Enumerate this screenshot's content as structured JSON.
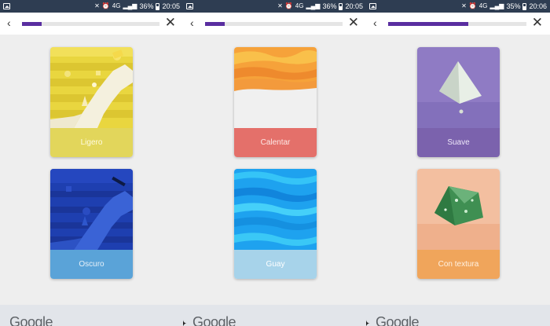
{
  "screens": [
    {
      "status": {
        "signal": "4G",
        "battery": "36%",
        "time": "20:05"
      },
      "progress": 0.14,
      "cards": [
        {
          "label": "Ligero",
          "art": "yellow-stairs-scene",
          "label_bg": "#e2d65b",
          "label_color": "#fffbe0"
        },
        {
          "label": "Oscuro",
          "art": "blue-stairs-scene",
          "label_bg": "#5aa3d8",
          "label_color": "#e6f0f8"
        }
      ],
      "footer": {
        "brand": "Google"
      }
    },
    {
      "status": {
        "signal": "4G",
        "battery": "36%",
        "time": "20:05"
      },
      "progress": 0.14,
      "cards": [
        {
          "label": "Calentar",
          "art": "orange-waves",
          "label_bg": "#e4706a",
          "label_color": "#fde8e6"
        },
        {
          "label": "Guay",
          "art": "cyan-waves",
          "label_bg": "#a7d3ea",
          "label_color": "#ffffff"
        }
      ],
      "footer": {
        "brand": "Google"
      }
    },
    {
      "status": {
        "signal": "4G",
        "battery": "35%",
        "time": "20:06"
      },
      "progress": 0.58,
      "cards": [
        {
          "label": "Suave",
          "art": "purple-pyramid",
          "label_bg": "#7b62ad",
          "label_color": "#efe9fa"
        },
        {
          "label": "Con textura",
          "art": "green-crystal-on-peach",
          "label_bg": "#f0a55b",
          "label_color": "#fff2e3"
        }
      ],
      "footer": {
        "brand": "Google"
      }
    }
  ]
}
